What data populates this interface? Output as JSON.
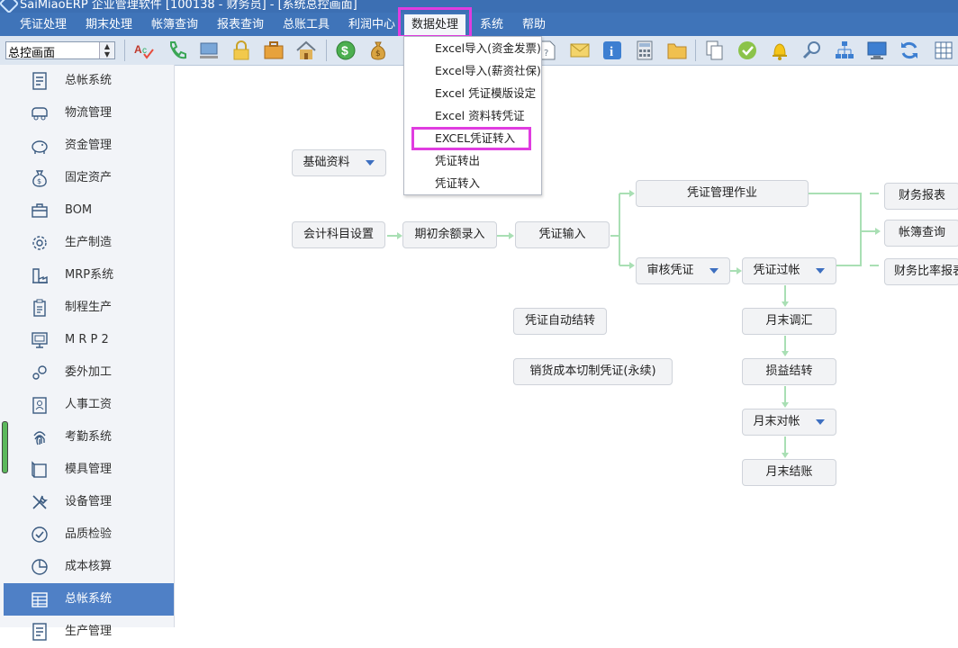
{
  "window": {
    "title": "SaiMiaoERP 企业管理软件 [100138 - 财务员] - [系统总控画面]"
  },
  "menubar": {
    "items": [
      "凭证处理",
      "期末处理",
      "帐簿查询",
      "报表查询",
      "总账工具",
      "利润中心",
      "数据处理",
      "系统",
      "帮助"
    ],
    "active": "数据处理"
  },
  "toolbar": {
    "combo_value": "总控画面",
    "icons": [
      "spell-check-icon",
      "phone-icon",
      "computer-icon",
      "lock-icon",
      "briefcase-icon",
      "home-icon",
      "dollar-icon",
      "money-bag-icon",
      "document-icon",
      "mail-icon",
      "info-icon",
      "calculator-icon",
      "folder-icon",
      "copy-icon",
      "check-icon",
      "bell-icon",
      "search-icon",
      "org-chart-icon",
      "monitor-icon",
      "refresh-icon",
      "grid-icon"
    ]
  },
  "sidebar": {
    "items": [
      {
        "label": "总帐系统",
        "icon": "ledger-icon"
      },
      {
        "label": "物流管理",
        "icon": "truck-icon"
      },
      {
        "label": "资金管理",
        "icon": "piggy-bank-icon"
      },
      {
        "label": "固定资产",
        "icon": "money-bag-icon"
      },
      {
        "label": "BOM",
        "icon": "toolbox-icon"
      },
      {
        "label": "生产制造",
        "icon": "gear-icon"
      },
      {
        "label": "MRP系统",
        "icon": "factory-icon"
      },
      {
        "label": "制程生产",
        "icon": "clipboard-icon"
      },
      {
        "label": "M R P 2",
        "icon": "monitor-icon"
      },
      {
        "label": "委外加工",
        "icon": "gears-icon"
      },
      {
        "label": "人事工资",
        "icon": "id-card-icon"
      },
      {
        "label": "考勤系统",
        "icon": "fingerprint-icon"
      },
      {
        "label": "模具管理",
        "icon": "mold-icon"
      },
      {
        "label": "设备管理",
        "icon": "tools-icon"
      },
      {
        "label": "品质检验",
        "icon": "check-circle-icon"
      },
      {
        "label": "成本核算",
        "icon": "pie-chart-icon"
      },
      {
        "label": "总帐系统",
        "icon": "table-icon",
        "active": true
      },
      {
        "label": "生产管理",
        "icon": "ledger-icon"
      }
    ]
  },
  "dropdown": {
    "items": [
      "Excel导入(资金发票)",
      "Excel导入(薪资社保)",
      "Excel 凭证模版设定",
      "Excel 资料转凭证",
      "EXCEL凭证转入",
      "凭证转出",
      "凭证转入"
    ],
    "highlighted": "EXCEL凭证转入"
  },
  "flow": {
    "basic": "基础资料",
    "account_setup": "会计科目设置",
    "opening_balance": "期初余额录入",
    "voucher_input": "凭证输入",
    "voucher_mgmt": "凭证管理作业",
    "audit": "审核凭证",
    "posting": "凭证过帐",
    "auto_transfer": "凭证自动结转",
    "sales_cost": "销货成本切制凭证(永续)",
    "month_adjust": "月末调汇",
    "pl_transfer": "损益结转",
    "month_reconcile": "月末对帐",
    "month_close": "月末结账",
    "fin_report": "财务报表",
    "book_query": "帐簿查询",
    "ratio_report": "财务比率报表"
  },
  "colors": {
    "menubar": "#3f74b9",
    "highlight": "#e03ce0",
    "sidebar_active": "#4f80c6",
    "connector": "#a9dfb4",
    "dropdown_arrow": "#3d6fc0"
  }
}
